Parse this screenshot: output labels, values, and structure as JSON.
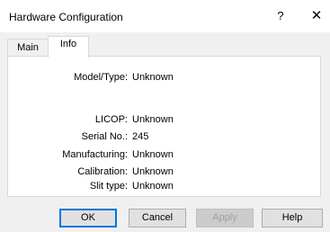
{
  "window": {
    "title": "Hardware Configuration",
    "help_glyph": "?",
    "close_glyph": "✕"
  },
  "tabs": [
    {
      "label": "Main"
    },
    {
      "label": "Info",
      "selected": true
    }
  ],
  "info": [
    {
      "label": "Model/Type:",
      "value": "Unknown"
    },
    {
      "label": "LICOP:",
      "value": "Unknown"
    },
    {
      "label": "Serial No.:",
      "value": "245"
    },
    {
      "label": "Manufacturing:",
      "value": "Unknown"
    },
    {
      "label": "Calibration:",
      "value": "Unknown"
    },
    {
      "label": "Slit type:",
      "value": "Unknown"
    }
  ],
  "buttons": {
    "ok": "OK",
    "cancel": "Cancel",
    "apply": "Apply",
    "help": "Help"
  }
}
